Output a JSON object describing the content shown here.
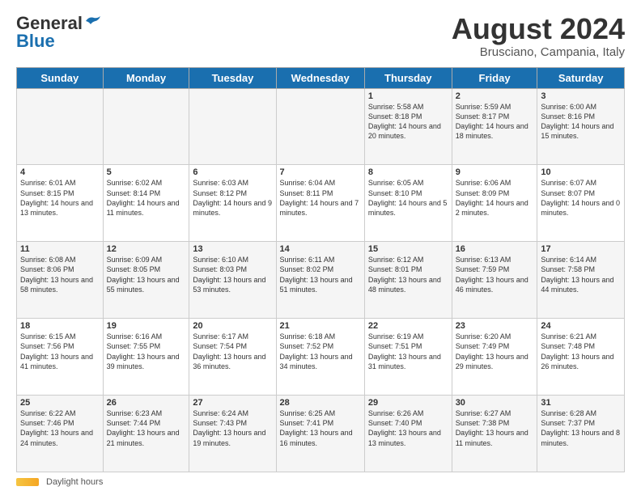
{
  "header": {
    "logo_general": "General",
    "logo_blue": "Blue",
    "main_title": "August 2024",
    "subtitle": "Brusciano, Campania, Italy"
  },
  "calendar": {
    "days_of_week": [
      "Sunday",
      "Monday",
      "Tuesday",
      "Wednesday",
      "Thursday",
      "Friday",
      "Saturday"
    ],
    "weeks": [
      [
        {
          "day": "",
          "text": ""
        },
        {
          "day": "",
          "text": ""
        },
        {
          "day": "",
          "text": ""
        },
        {
          "day": "",
          "text": ""
        },
        {
          "day": "1",
          "text": "Sunrise: 5:58 AM\nSunset: 8:18 PM\nDaylight: 14 hours\nand 20 minutes."
        },
        {
          "day": "2",
          "text": "Sunrise: 5:59 AM\nSunset: 8:17 PM\nDaylight: 14 hours\nand 18 minutes."
        },
        {
          "day": "3",
          "text": "Sunrise: 6:00 AM\nSunset: 8:16 PM\nDaylight: 14 hours\nand 15 minutes."
        }
      ],
      [
        {
          "day": "4",
          "text": "Sunrise: 6:01 AM\nSunset: 8:15 PM\nDaylight: 14 hours\nand 13 minutes."
        },
        {
          "day": "5",
          "text": "Sunrise: 6:02 AM\nSunset: 8:14 PM\nDaylight: 14 hours\nand 11 minutes."
        },
        {
          "day": "6",
          "text": "Sunrise: 6:03 AM\nSunset: 8:12 PM\nDaylight: 14 hours\nand 9 minutes."
        },
        {
          "day": "7",
          "text": "Sunrise: 6:04 AM\nSunset: 8:11 PM\nDaylight: 14 hours\nand 7 minutes."
        },
        {
          "day": "8",
          "text": "Sunrise: 6:05 AM\nSunset: 8:10 PM\nDaylight: 14 hours\nand 5 minutes."
        },
        {
          "day": "9",
          "text": "Sunrise: 6:06 AM\nSunset: 8:09 PM\nDaylight: 14 hours\nand 2 minutes."
        },
        {
          "day": "10",
          "text": "Sunrise: 6:07 AM\nSunset: 8:07 PM\nDaylight: 14 hours\nand 0 minutes."
        }
      ],
      [
        {
          "day": "11",
          "text": "Sunrise: 6:08 AM\nSunset: 8:06 PM\nDaylight: 13 hours\nand 58 minutes."
        },
        {
          "day": "12",
          "text": "Sunrise: 6:09 AM\nSunset: 8:05 PM\nDaylight: 13 hours\nand 55 minutes."
        },
        {
          "day": "13",
          "text": "Sunrise: 6:10 AM\nSunset: 8:03 PM\nDaylight: 13 hours\nand 53 minutes."
        },
        {
          "day": "14",
          "text": "Sunrise: 6:11 AM\nSunset: 8:02 PM\nDaylight: 13 hours\nand 51 minutes."
        },
        {
          "day": "15",
          "text": "Sunrise: 6:12 AM\nSunset: 8:01 PM\nDaylight: 13 hours\nand 48 minutes."
        },
        {
          "day": "16",
          "text": "Sunrise: 6:13 AM\nSunset: 7:59 PM\nDaylight: 13 hours\nand 46 minutes."
        },
        {
          "day": "17",
          "text": "Sunrise: 6:14 AM\nSunset: 7:58 PM\nDaylight: 13 hours\nand 44 minutes."
        }
      ],
      [
        {
          "day": "18",
          "text": "Sunrise: 6:15 AM\nSunset: 7:56 PM\nDaylight: 13 hours\nand 41 minutes."
        },
        {
          "day": "19",
          "text": "Sunrise: 6:16 AM\nSunset: 7:55 PM\nDaylight: 13 hours\nand 39 minutes."
        },
        {
          "day": "20",
          "text": "Sunrise: 6:17 AM\nSunset: 7:54 PM\nDaylight: 13 hours\nand 36 minutes."
        },
        {
          "day": "21",
          "text": "Sunrise: 6:18 AM\nSunset: 7:52 PM\nDaylight: 13 hours\nand 34 minutes."
        },
        {
          "day": "22",
          "text": "Sunrise: 6:19 AM\nSunset: 7:51 PM\nDaylight: 13 hours\nand 31 minutes."
        },
        {
          "day": "23",
          "text": "Sunrise: 6:20 AM\nSunset: 7:49 PM\nDaylight: 13 hours\nand 29 minutes."
        },
        {
          "day": "24",
          "text": "Sunrise: 6:21 AM\nSunset: 7:48 PM\nDaylight: 13 hours\nand 26 minutes."
        }
      ],
      [
        {
          "day": "25",
          "text": "Sunrise: 6:22 AM\nSunset: 7:46 PM\nDaylight: 13 hours\nand 24 minutes."
        },
        {
          "day": "26",
          "text": "Sunrise: 6:23 AM\nSunset: 7:44 PM\nDaylight: 13 hours\nand 21 minutes."
        },
        {
          "day": "27",
          "text": "Sunrise: 6:24 AM\nSunset: 7:43 PM\nDaylight: 13 hours\nand 19 minutes."
        },
        {
          "day": "28",
          "text": "Sunrise: 6:25 AM\nSunset: 7:41 PM\nDaylight: 13 hours\nand 16 minutes."
        },
        {
          "day": "29",
          "text": "Sunrise: 6:26 AM\nSunset: 7:40 PM\nDaylight: 13 hours\nand 13 minutes."
        },
        {
          "day": "30",
          "text": "Sunrise: 6:27 AM\nSunset: 7:38 PM\nDaylight: 13 hours\nand 11 minutes."
        },
        {
          "day": "31",
          "text": "Sunrise: 6:28 AM\nSunset: 7:37 PM\nDaylight: 13 hours\nand 8 minutes."
        }
      ]
    ]
  },
  "footer": {
    "daylight_label": "Daylight hours"
  }
}
